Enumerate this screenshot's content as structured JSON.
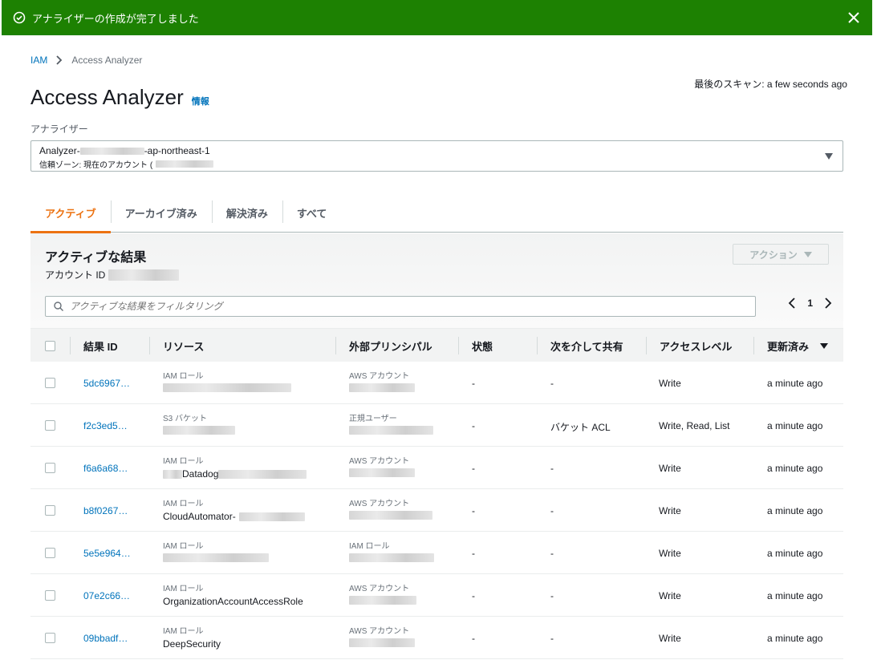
{
  "flash": {
    "message": "アナライザーの作成が完了しました"
  },
  "breadcrumb": {
    "root": "IAM",
    "current": "Access Analyzer"
  },
  "last_scan": "最後のスキャン: a few seconds ago",
  "title": "Access Analyzer",
  "info_link": "情報",
  "analyzer": {
    "label": "アナライザー",
    "name_prefix": "Analyzer-",
    "name_suffix": "-ap-northeast-1",
    "zone_prefix": "信頼ゾーン: 現在のアカウント ("
  },
  "tabs": [
    "アクティブ",
    "アーカイブ済み",
    "解決済み",
    "すべて"
  ],
  "panel": {
    "title": "アクティブな結果",
    "account_label": "アカウント ID",
    "action_label": "アクション",
    "filter_placeholder": "アクティブな結果をフィルタリング",
    "page": "1"
  },
  "columns": [
    "結果 ID",
    "リソース",
    "外部プリンシパル",
    "状態",
    "次を介して共有",
    "アクセスレベル",
    "更新済み"
  ],
  "rows": [
    {
      "id": "5dc6967…",
      "resource_type": "IAM ロール",
      "resource": "",
      "principal_type": "AWS アカウント",
      "status": "-",
      "shared": "-",
      "access": "Write",
      "updated": "a minute ago"
    },
    {
      "id": "f2c3ed5…",
      "resource_type": "S3 バケット",
      "resource": "",
      "principal_type": "正規ユーザー",
      "status": "-",
      "shared": "バケット ACL",
      "access": "Write, Read, List",
      "updated": "a minute ago"
    },
    {
      "id": "f6a6a68…",
      "resource_type": "IAM ロール",
      "resource": "Datadog",
      "principal_type": "AWS アカウント",
      "status": "-",
      "shared": "-",
      "access": "Write",
      "updated": "a minute ago"
    },
    {
      "id": "b8f0267…",
      "resource_type": "IAM ロール",
      "resource": "CloudAutomator-",
      "principal_type": "AWS アカウント",
      "status": "-",
      "shared": "-",
      "access": "Write",
      "updated": "a minute ago"
    },
    {
      "id": "5e5e964…",
      "resource_type": "IAM ロール",
      "resource": "",
      "principal_type": "IAM ロール",
      "status": "-",
      "shared": "-",
      "access": "Write",
      "updated": "a minute ago"
    },
    {
      "id": "07e2c66…",
      "resource_type": "IAM ロール",
      "resource": "OrganizationAccountAccessRole",
      "principal_type": "AWS アカウント",
      "status": "-",
      "shared": "-",
      "access": "Write",
      "updated": "a minute ago"
    },
    {
      "id": "09bbadf…",
      "resource_type": "IAM ロール",
      "resource": "DeepSecurity",
      "principal_type": "AWS アカウント",
      "status": "-",
      "shared": "-",
      "access": "Write",
      "updated": "a minute ago"
    }
  ]
}
